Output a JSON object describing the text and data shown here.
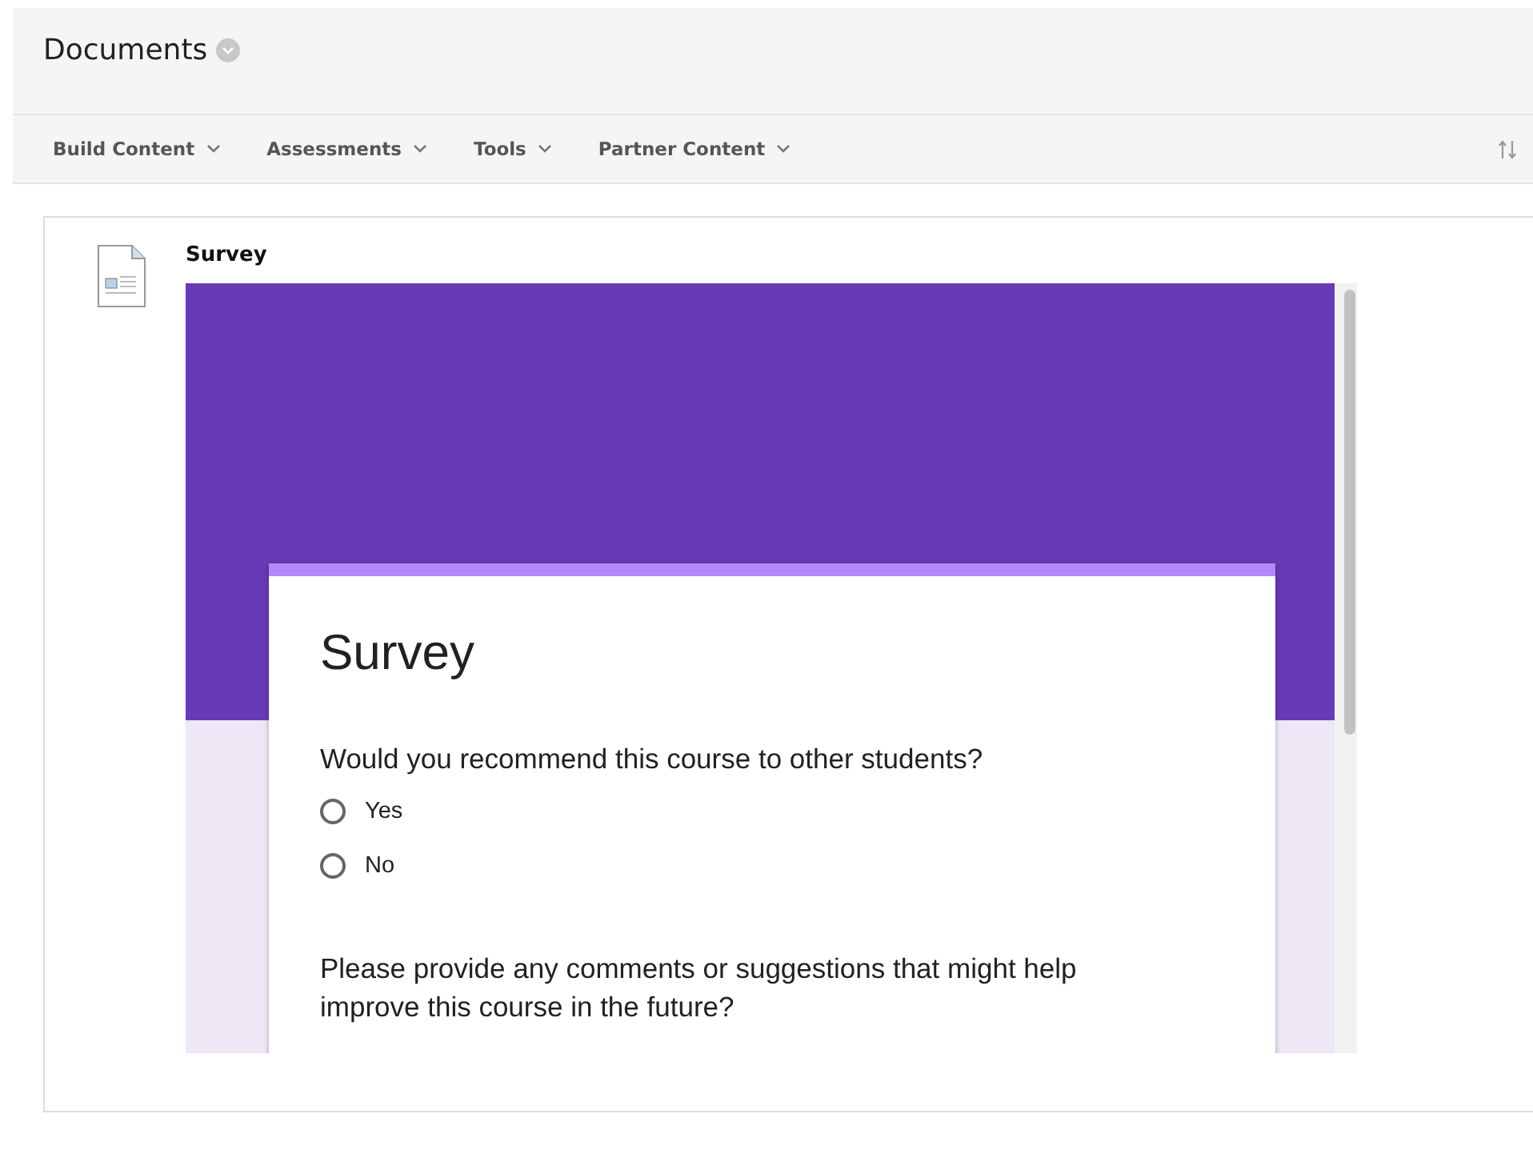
{
  "page": {
    "title": "Documents"
  },
  "toolbar": {
    "menus": [
      {
        "label": "Build Content"
      },
      {
        "label": "Assessments"
      },
      {
        "label": "Tools"
      },
      {
        "label": "Partner Content"
      }
    ]
  },
  "item": {
    "title": "Survey",
    "form": {
      "title": "Survey",
      "questions": [
        {
          "kind": "radio",
          "text": "Would you recommend this course to other students?",
          "options": [
            {
              "label": "Yes",
              "selected": false
            },
            {
              "label": "No",
              "selected": false
            }
          ]
        },
        {
          "kind": "text",
          "text": "Please provide any comments or suggestions that might help improve this course in the future?"
        }
      ]
    }
  }
}
